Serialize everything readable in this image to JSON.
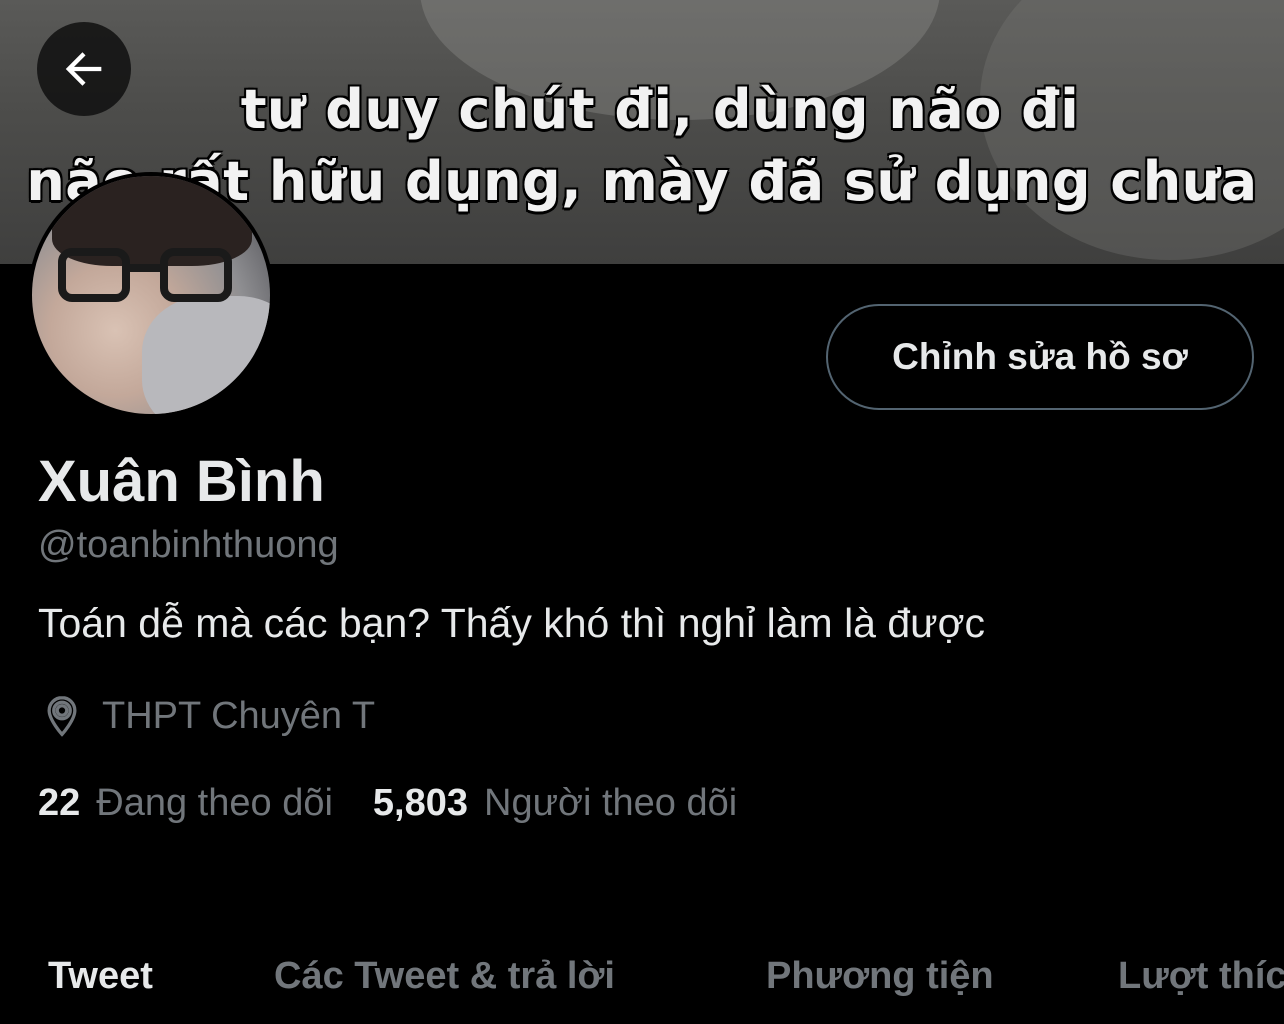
{
  "banner": {
    "line1": "tư duy chút đi, dùng não đi",
    "line2": "não rất hữu dụng, mày đã sử dụng chưa"
  },
  "header": {
    "back_icon": "arrow-left-icon"
  },
  "profile": {
    "edit_button_label": "Chỉnh sửa hồ sơ",
    "display_name": "Xuân Bình",
    "handle": "@toanbinhthuong",
    "bio": "Toán dễ mà các bạn? Thấy khó thì nghỉ làm là được",
    "location_icon": "location-pin-icon",
    "location": "THPT Chuyên T",
    "following_count": "22",
    "following_label": "Đang theo dõi",
    "followers_count": "5,803",
    "followers_label": "Người theo dõi"
  },
  "tabs": [
    {
      "label": "Tweet",
      "active": true
    },
    {
      "label": "Các Tweet & trả lời",
      "active": false
    },
    {
      "label": "Phương tiện",
      "active": false
    },
    {
      "label": "Lượt thích",
      "active": false
    }
  ],
  "colors": {
    "background": "#000000",
    "primary_text": "#e7e9ea",
    "secondary_text": "#71767b",
    "button_border": "#536471"
  }
}
